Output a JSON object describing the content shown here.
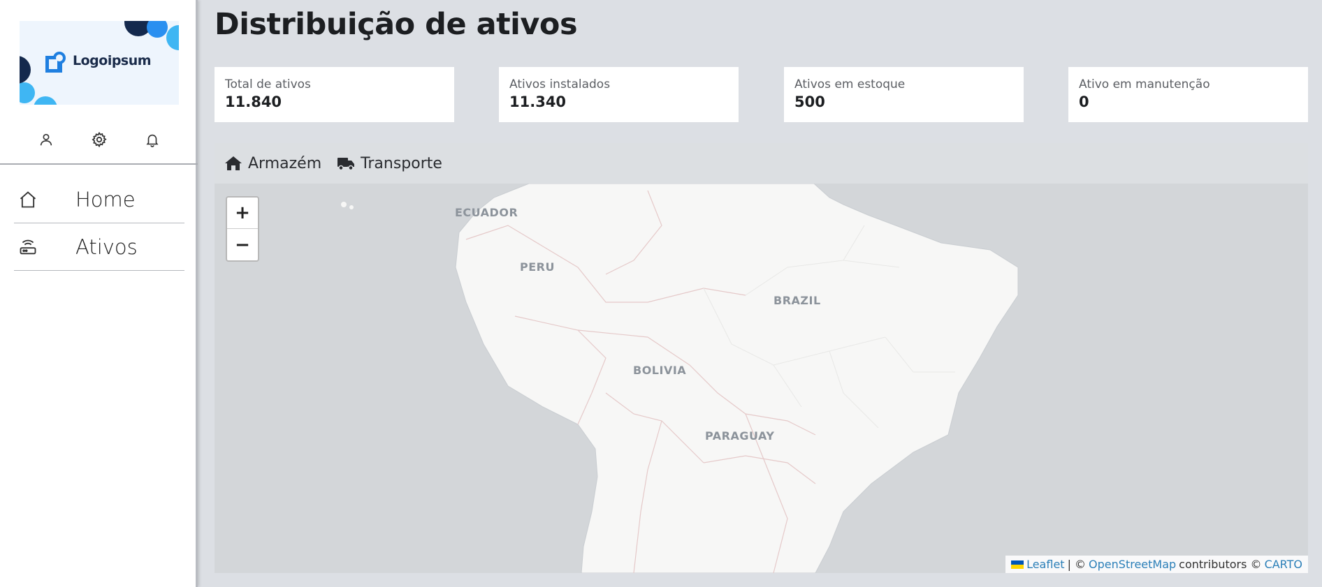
{
  "brand": {
    "logo_text": "Logoipsum"
  },
  "sidebar": {
    "icons": [
      {
        "name": "user-icon"
      },
      {
        "name": "gear-icon"
      },
      {
        "name": "bell-icon"
      }
    ],
    "nav": [
      {
        "label": "Home",
        "icon": "home-icon"
      },
      {
        "label": "Ativos",
        "icon": "router-icon"
      }
    ]
  },
  "page": {
    "title": "Distribuição de ativos"
  },
  "stats": [
    {
      "label": "Total de ativos",
      "value": "11.840"
    },
    {
      "label": "Ativos instalados",
      "value": "11.340"
    },
    {
      "label": "Ativos em estoque",
      "value": "500"
    },
    {
      "label": "Ativo em manutenção",
      "value": "0"
    }
  ],
  "map": {
    "tabs": [
      {
        "label": "Armazém",
        "icon": "warehouse-icon"
      },
      {
        "label": "Transporte",
        "icon": "truck-icon"
      }
    ],
    "zoom_in": "+",
    "zoom_out": "−",
    "countries": [
      "ECUADOR",
      "PERU",
      "BRAZIL",
      "BOLIVIA",
      "PARAGUAY"
    ],
    "attribution": {
      "leaflet": "Leaflet",
      "sep1": "| ©",
      "osm": "OpenStreetMap",
      "contributors": "contributors ©",
      "carto": "CARTO"
    }
  },
  "colors": {
    "accent": "#1f7fe0",
    "link": "#2b7fb8",
    "background": "#dcdfe4"
  }
}
